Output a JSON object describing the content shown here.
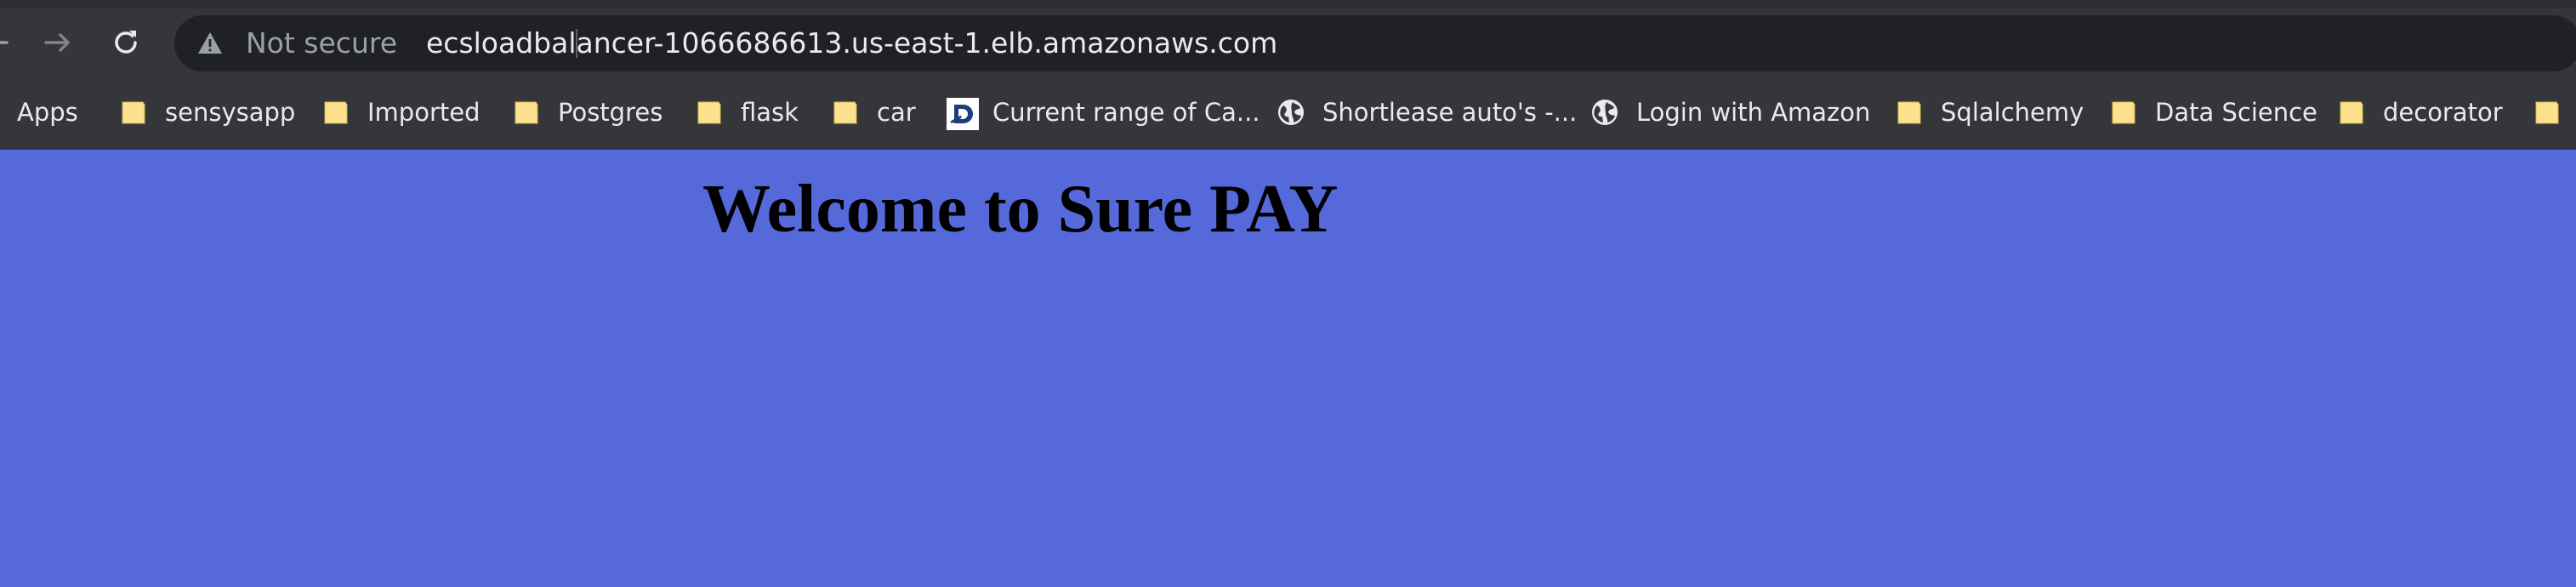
{
  "browser": {
    "security_label": "Not secure",
    "url": "ecsloadbalancer-1066686613.us-east-1.elb.amazonaws.com",
    "bookmarks": [
      {
        "label": "Apps",
        "icon": "apps-icon"
      },
      {
        "label": "sensysapp",
        "icon": "folder-icon"
      },
      {
        "label": "Imported",
        "icon": "folder-icon"
      },
      {
        "label": "Postgres",
        "icon": "folder-icon"
      },
      {
        "label": "flask",
        "icon": "folder-icon"
      },
      {
        "label": "car",
        "icon": "folder-icon"
      },
      {
        "label": "Current range of Ca...",
        "icon": "site-icon"
      },
      {
        "label": "Shortlease auto's -...",
        "icon": "globe-icon"
      },
      {
        "label": "Login with Amazon",
        "icon": "globe-icon"
      },
      {
        "label": "Sqlalchemy",
        "icon": "folder-icon"
      },
      {
        "label": "Data Science",
        "icon": "folder-icon"
      },
      {
        "label": "decorator",
        "icon": "folder-icon"
      }
    ]
  },
  "page": {
    "title": "Welcome to Sure PAY",
    "background_color": "#5569da"
  }
}
